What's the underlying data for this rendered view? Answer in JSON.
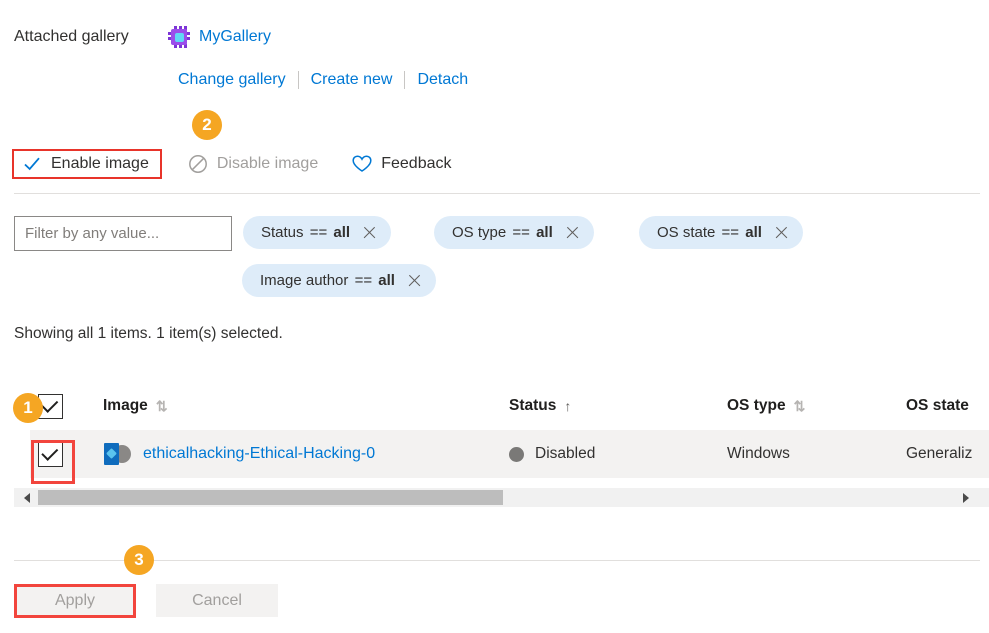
{
  "attached_gallery": {
    "label": "Attached gallery",
    "gallery_name": "MyGallery",
    "gallery_icon": "chip-icon",
    "links": [
      {
        "label": "Change gallery"
      },
      {
        "label": "Create new"
      },
      {
        "label": "Detach"
      }
    ]
  },
  "command_bar": {
    "commands": [
      {
        "label": "Enable image",
        "icon": "checkmark-icon",
        "enabled": true
      },
      {
        "label": "Disable image",
        "icon": "block-icon",
        "enabled": false
      },
      {
        "label": "Feedback",
        "icon": "heart-icon",
        "enabled": true
      }
    ]
  },
  "filters": {
    "input_placeholder": "Filter by any value...",
    "input_value": "",
    "pills": [
      {
        "field": "Status",
        "operator": "==",
        "value": "all"
      },
      {
        "field": "OS type",
        "operator": "==",
        "value": "all"
      },
      {
        "field": "OS state",
        "operator": "==",
        "value": "all"
      },
      {
        "field": "Image author",
        "operator": "==",
        "value": "all"
      }
    ]
  },
  "summary": {
    "text": "Showing all 1 items.  1 item(s) selected."
  },
  "table": {
    "select_all_checked": true,
    "columns": [
      {
        "label": "Image",
        "sort": "both"
      },
      {
        "label": "Status",
        "sort": "asc"
      },
      {
        "label": "OS type",
        "sort": "both"
      },
      {
        "label": "OS state",
        "sort": "none"
      }
    ],
    "rows": [
      {
        "checked": true,
        "image": "ethicalhacking-Ethical-Hacking-0",
        "status": "Disabled",
        "os_type": "Windows",
        "os_state": "Generaliz"
      }
    ]
  },
  "footer": {
    "apply_label": "Apply",
    "cancel_label": "Cancel"
  },
  "annotations": {
    "badges": [
      {
        "number": "1"
      },
      {
        "number": "2"
      },
      {
        "number": "3"
      }
    ],
    "highlight_color": "#f2453d",
    "badge_color": "#f5a623"
  }
}
